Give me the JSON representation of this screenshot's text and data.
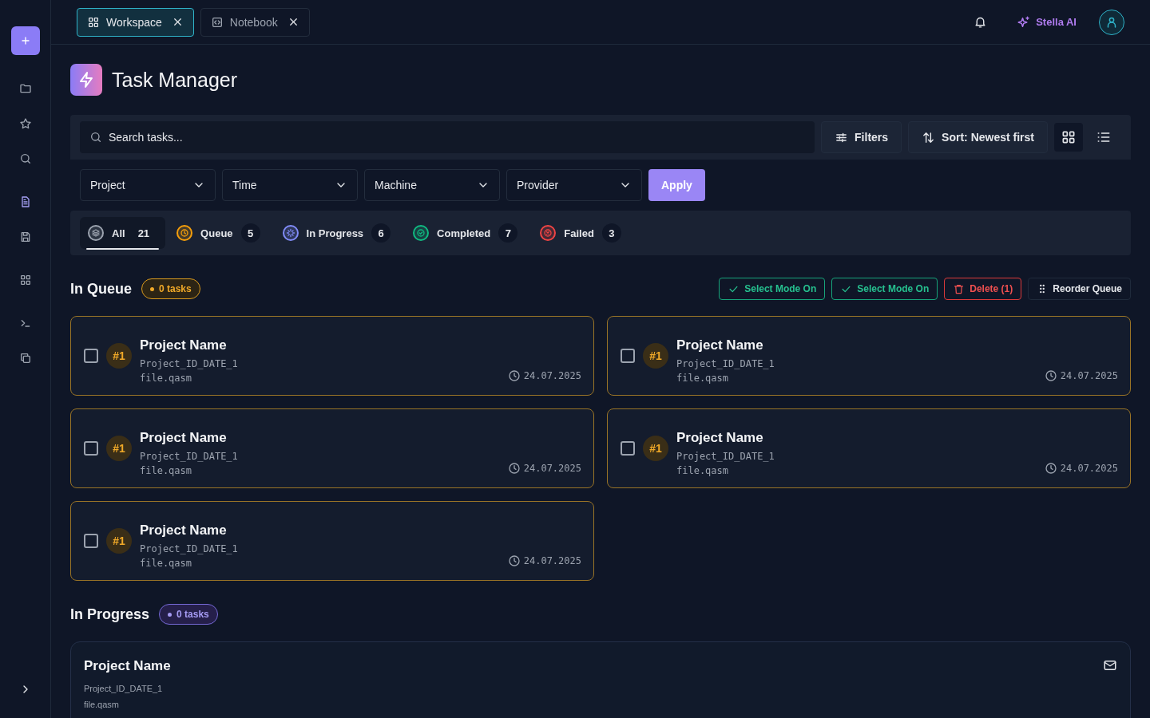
{
  "sidebar": {
    "items": [
      {
        "selected": false
      },
      {
        "selected": false
      },
      {
        "selected": false
      },
      {
        "selected": true
      },
      {
        "selected": false
      },
      {
        "selected": false
      },
      {
        "selected": false
      },
      {
        "selected": false
      }
    ]
  },
  "tabs": [
    {
      "label": "Workspace",
      "selected": true
    },
    {
      "label": "Notebook",
      "selected": false
    }
  ],
  "header": {
    "assistant": "Stella AI"
  },
  "page": {
    "title": "Task Manager"
  },
  "toolbar": {
    "search": {
      "placeholder": "Search tasks..."
    },
    "filters_button": "Filters",
    "sort_button": "Sort: Newest first",
    "views": [
      {
        "selected": true
      },
      {
        "selected": false
      }
    ]
  },
  "dropdowns": [
    "Project",
    "Time",
    "Machine",
    "Provider"
  ],
  "apply_button": "Apply",
  "status_tabs": [
    {
      "label": "All",
      "count": "21",
      "selected": true,
      "color": "#9ca3af"
    },
    {
      "label": "Queue",
      "count": "5",
      "selected": false,
      "color": "#f59e0b"
    },
    {
      "label": "In Progress",
      "count": "6",
      "selected": false,
      "color": "#818cf8"
    },
    {
      "label": "Completed",
      "count": "7",
      "selected": false,
      "color": "#10b981"
    },
    {
      "label": "Failed",
      "count": "3",
      "selected": false,
      "color": "#ef4444"
    }
  ],
  "sections": [
    {
      "kind": "queue",
      "title": "In Queue",
      "badge": "0 tasks",
      "actions": [
        {
          "kind": "select",
          "label": "Select Mode On"
        },
        {
          "kind": "select",
          "label": "Select Mode On"
        },
        {
          "kind": "delete",
          "label": "Delete (1)"
        },
        {
          "kind": "reorder",
          "label": "Reorder Queue"
        }
      ],
      "tasks": [
        {
          "rank": "#1",
          "name": "Project Name",
          "id": "Project_ID_DATE_1",
          "file": "file.qasm",
          "date": "24.07.2025",
          "checked": false
        },
        {
          "rank": "#1",
          "name": "Project Name",
          "id": "Project_ID_DATE_1",
          "file": "file.qasm",
          "date": "24.07.2025",
          "checked": false
        },
        {
          "rank": "#1",
          "name": "Project Name",
          "id": "Project_ID_DATE_1",
          "file": "file.qasm",
          "date": "24.07.2025",
          "checked": false
        },
        {
          "rank": "#1",
          "name": "Project Name",
          "id": "Project_ID_DATE_1",
          "file": "file.qasm",
          "date": "24.07.2025",
          "checked": false
        },
        {
          "rank": "#1",
          "name": "Project Name",
          "id": "Project_ID_DATE_1",
          "file": "file.qasm",
          "date": "24.07.2025",
          "checked": false
        }
      ]
    },
    {
      "kind": "progress",
      "title": "In Progress",
      "badge": "0 tasks",
      "tasks": [
        {
          "name": "Project Name",
          "id": "Project_ID_DATE_1",
          "file": "file.qasm"
        }
      ]
    }
  ]
}
